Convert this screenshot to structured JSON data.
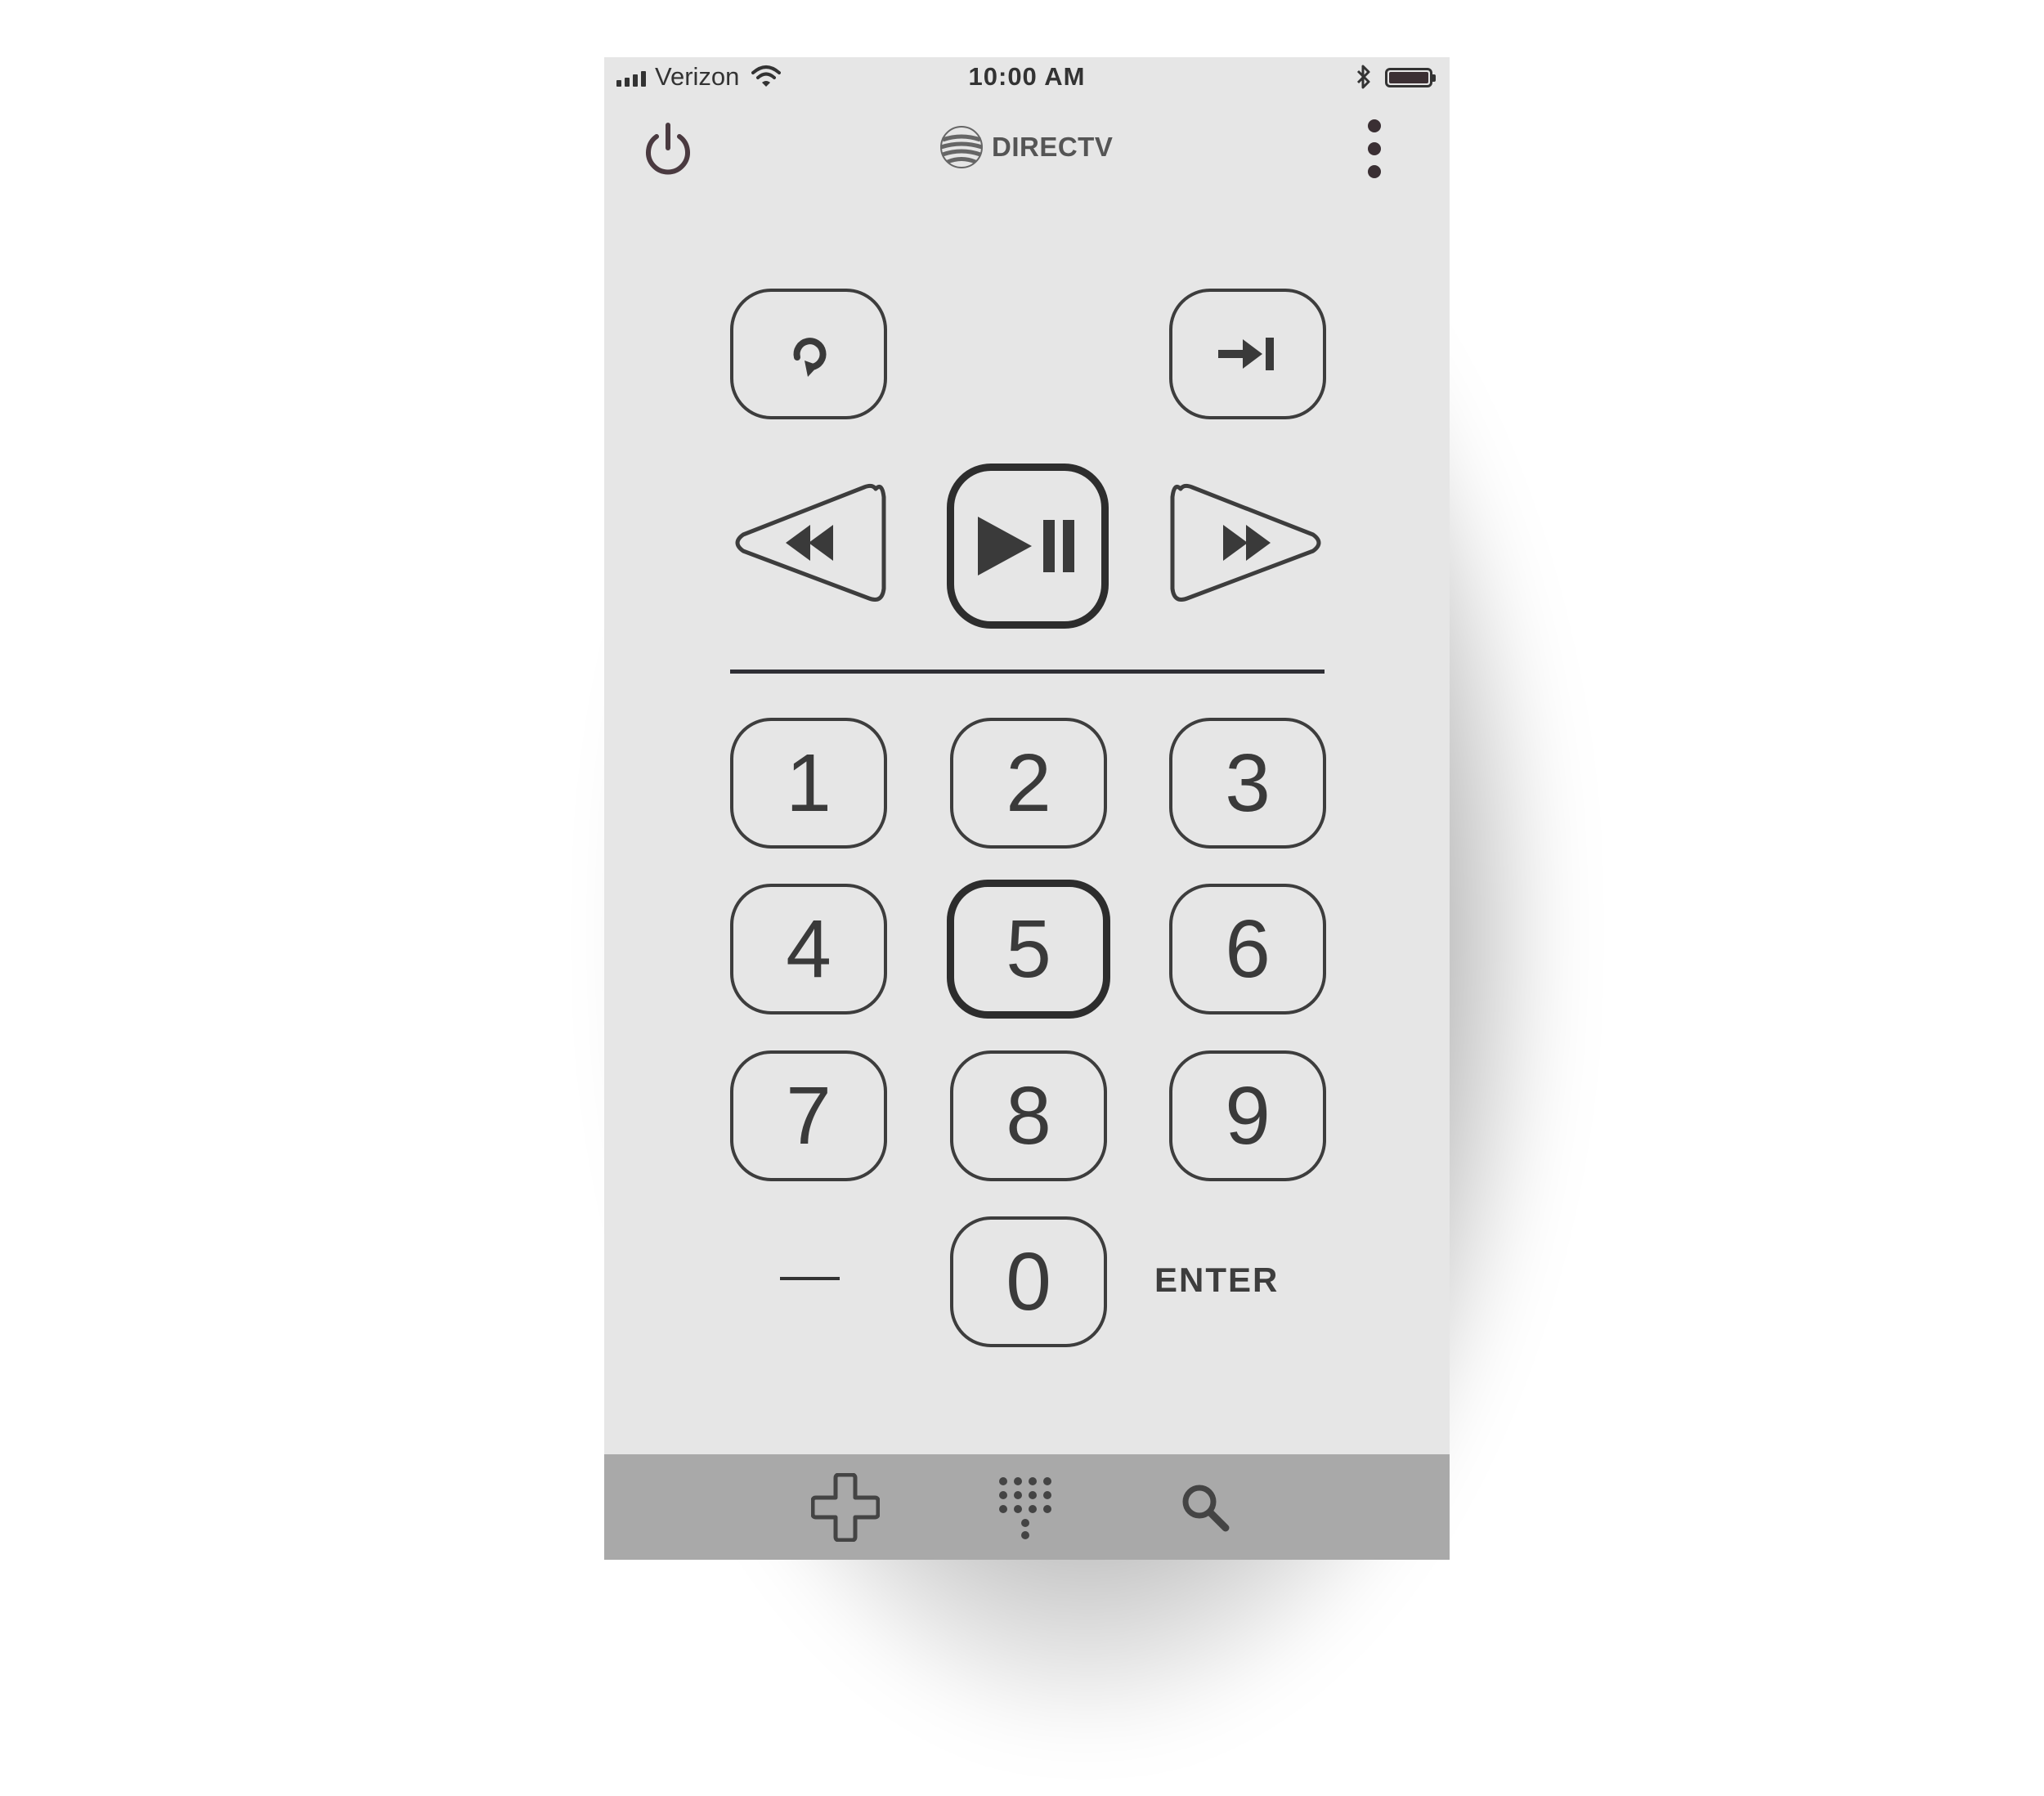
{
  "status_bar": {
    "carrier": "Verizon",
    "time": "10:00 AM",
    "signal_icon": "signal-bars-icon",
    "wifi_icon": "wifi-icon",
    "bluetooth_icon": "bluetooth-icon",
    "battery_icon": "battery-icon",
    "battery_level": 1.0
  },
  "header": {
    "power_icon": "power-icon",
    "brand_logo_icon": "att-globe-icon",
    "brand_name": "DIRECTV",
    "more_icon": "more-vertical-icon"
  },
  "transport": {
    "replay_icon": "replay-icon",
    "skip_icon": "skip-forward-icon",
    "rewind_icon": "rewind-icon",
    "play_pause_icon": "play-pause-icon",
    "fast_forward_icon": "fast-forward-icon"
  },
  "keypad": {
    "keys": [
      "1",
      "2",
      "3",
      "4",
      "5",
      "6",
      "7",
      "8",
      "9",
      "0"
    ],
    "dash_label": "—",
    "enter_label": "ENTER",
    "highlighted_key": "5"
  },
  "tab_bar": {
    "tabs": [
      "dpad-icon",
      "keypad-icon",
      "search-icon"
    ]
  },
  "colors": {
    "screen_background": "#e6e6e6",
    "tab_bar_background": "#a9a9a9",
    "button_outline": "#3d3d3d",
    "power_icon": "#4a3a40"
  }
}
